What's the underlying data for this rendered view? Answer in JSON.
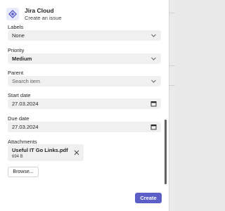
{
  "app": {
    "name": "Jira Cloud",
    "subtitle": "Create an issue",
    "icon": "jira-app-icon"
  },
  "form": {
    "labels": {
      "label": "Labels",
      "value": "None",
      "icon": "chevron-down-icon"
    },
    "priority": {
      "label": "Priority",
      "value": "Medium",
      "icon": "chevron-down-icon"
    },
    "parent": {
      "label": "Parent",
      "placeholder": "Search item",
      "icon": "chevron-down-icon"
    },
    "start_date": {
      "label": "Start date",
      "value": "27.03.2024",
      "icon": "calendar-icon"
    },
    "due_date": {
      "label": "Due date",
      "value": "27.03.2024",
      "icon": "calendar-icon"
    },
    "attachments": {
      "label": "Attachments",
      "files": [
        {
          "name": "Useful IT Go Links.pdf",
          "size": "694 B"
        }
      ],
      "browse_label": "Browse..."
    }
  },
  "actions": {
    "create_label": "Create"
  },
  "colors": {
    "accent": "#5b5fc7",
    "field_bg": "#f0f0f0",
    "text": "#242424"
  }
}
